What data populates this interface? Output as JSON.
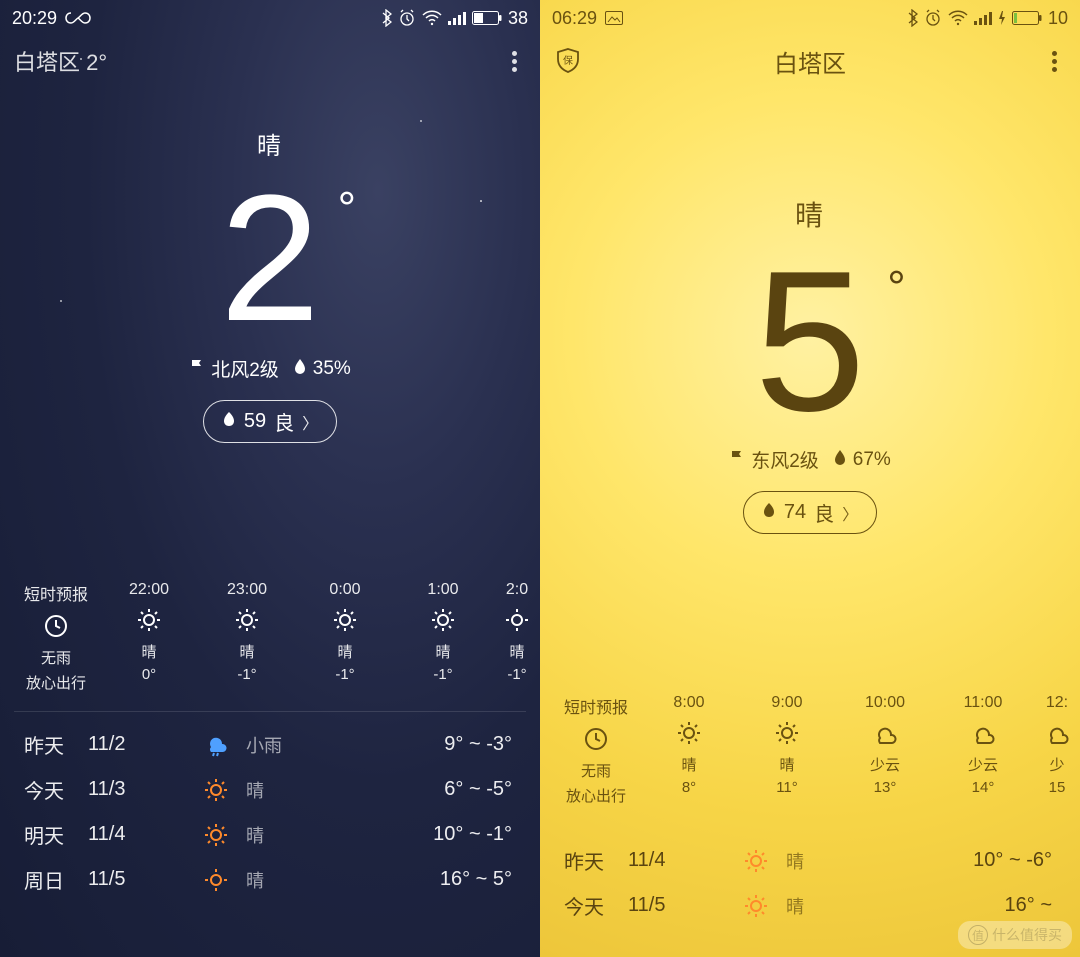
{
  "left": {
    "statusbar": {
      "time": "20:29",
      "battery": "38"
    },
    "appbar": {
      "title": "白塔区 2°"
    },
    "hero": {
      "condition": "晴",
      "temp": "2",
      "degree": "°",
      "wind": "北风2级",
      "humidity": "35%",
      "aqi_value": "59",
      "aqi_label": "良"
    },
    "hourly_header": {
      "title": "短时预报",
      "sub1": "无雨",
      "sub2": "放心出行"
    },
    "hourly": [
      {
        "time": "22:00",
        "icon": "sun",
        "cond": "晴",
        "temp": "0°"
      },
      {
        "time": "23:00",
        "icon": "sun",
        "cond": "晴",
        "temp": "-1°"
      },
      {
        "time": "0:00",
        "icon": "sun",
        "cond": "晴",
        "temp": "-1°"
      },
      {
        "time": "1:00",
        "icon": "sun",
        "cond": "晴",
        "temp": "-1°"
      },
      {
        "time": "2:0",
        "icon": "sun",
        "cond": "晴",
        "temp": "-1°"
      }
    ],
    "daily": [
      {
        "label": "昨天",
        "date": "11/2",
        "icon": "rain",
        "cond": "小雨",
        "range": "9° ~ -3°"
      },
      {
        "label": "今天",
        "date": "11/3",
        "icon": "sun-orange",
        "cond": "晴",
        "range": "6° ~ -5°"
      },
      {
        "label": "明天",
        "date": "11/4",
        "icon": "sun-orange",
        "cond": "晴",
        "range": "10° ~ -1°"
      },
      {
        "label": "周日",
        "date": "11/5",
        "icon": "sun-orange",
        "cond": "晴",
        "range": "16° ~ 5°"
      }
    ]
  },
  "right": {
    "statusbar": {
      "time": "06:29",
      "battery": "10"
    },
    "appbar": {
      "title": "白塔区"
    },
    "hero": {
      "condition": "晴",
      "temp": "5",
      "degree": "°",
      "wind": "东风2级",
      "humidity": "67%",
      "aqi_value": "74",
      "aqi_label": "良"
    },
    "hourly_header": {
      "title": "短时预报",
      "sub1": "无雨",
      "sub2": "放心出行"
    },
    "hourly": [
      {
        "time": "8:00",
        "icon": "sun",
        "cond": "晴",
        "temp": "8°"
      },
      {
        "time": "9:00",
        "icon": "sun",
        "cond": "晴",
        "temp": "11°"
      },
      {
        "time": "10:00",
        "icon": "cloud",
        "cond": "少云",
        "temp": "13°"
      },
      {
        "time": "11:00",
        "icon": "cloud",
        "cond": "少云",
        "temp": "14°"
      },
      {
        "time": "12:",
        "icon": "cloud",
        "cond": "少",
        "temp": "15"
      }
    ],
    "daily": [
      {
        "label": "昨天",
        "date": "11/4",
        "icon": "sun-orange",
        "cond": "晴",
        "range": "10° ~ -6°"
      },
      {
        "label": "今天",
        "date": "11/5",
        "icon": "sun-orange",
        "cond": "晴",
        "range": "16° ~ "
      }
    ]
  },
  "watermark": {
    "badge": "值",
    "text": "什么值得买"
  }
}
